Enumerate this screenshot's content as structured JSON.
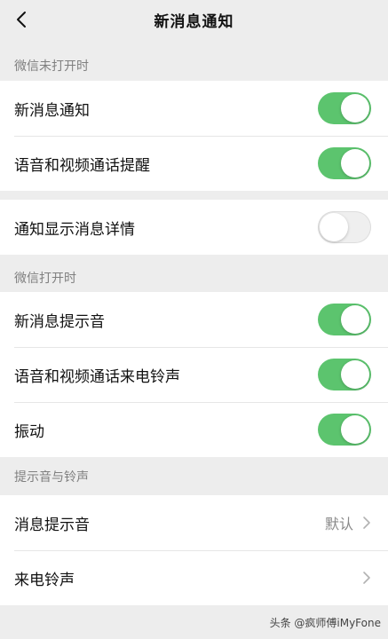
{
  "header": {
    "title": "新消息通知",
    "back_icon": "chevron-left-icon"
  },
  "sections": {
    "closed": {
      "title": "微信未打开时"
    },
    "open": {
      "title": "微信打开时"
    },
    "sounds": {
      "title": "提示音与铃声"
    }
  },
  "rows": {
    "new_message_notify": {
      "label": "新消息通知",
      "enabled": true
    },
    "call_reminder": {
      "label": "语音和视频通话提醒",
      "enabled": true
    },
    "show_details": {
      "label": "通知显示消息详情",
      "enabled": false
    },
    "new_message_sound": {
      "label": "新消息提示音",
      "enabled": true
    },
    "call_ringtone_open": {
      "label": "语音和视频通话来电铃声",
      "enabled": true
    },
    "vibration": {
      "label": "振动",
      "enabled": true
    },
    "message_sound": {
      "label": "消息提示音",
      "value": "默认"
    },
    "incoming_ringtone": {
      "label": "来电铃声"
    }
  },
  "watermark": {
    "text": "头条 @疯师傅iMyFone"
  },
  "colors": {
    "toggle_on": "#5cc46e",
    "toggle_off": "#efefef",
    "background": "#ededed",
    "section_text": "#7f7f7f"
  }
}
